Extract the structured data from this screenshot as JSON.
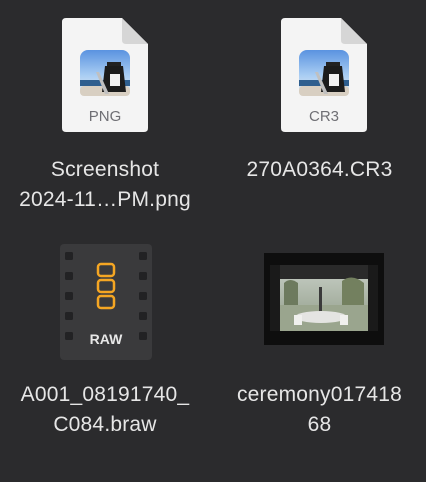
{
  "files": [
    {
      "name_line1": "Screenshot",
      "name_line2": "2024-11…PM.png",
      "ext": "PNG",
      "icon": "preview-document-icon"
    },
    {
      "name_line1": "270A0364.CR3",
      "name_line2": "",
      "ext": "CR3",
      "icon": "preview-document-icon"
    },
    {
      "name_line1": "A001_08191740_",
      "name_line2": "C084.braw",
      "badge": "RAW",
      "icon": "braw-film-icon"
    },
    {
      "name_line1": "ceremony017418",
      "name_line2": "68",
      "icon": "video-thumbnail"
    }
  ]
}
